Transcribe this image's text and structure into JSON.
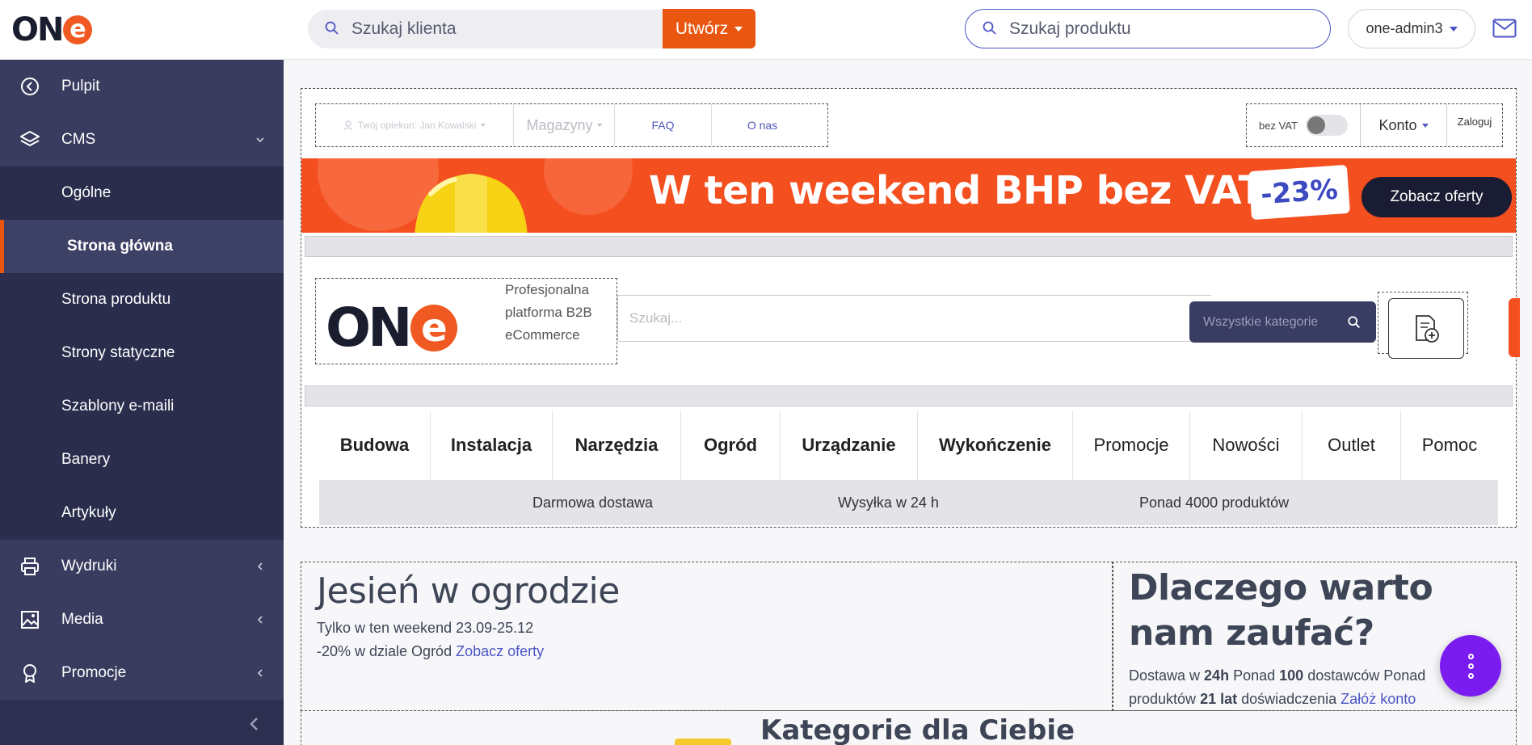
{
  "topbar": {
    "client_search_placeholder": "Szukaj klienta",
    "create_label": "Utwórz",
    "product_search_placeholder": "Szukaj produktu",
    "admin_label": "one-admin3"
  },
  "sidebar": {
    "items": [
      {
        "label": "Pulpit",
        "icon": "dashboard-icon"
      },
      {
        "label": "CMS",
        "icon": "layers-icon"
      },
      {
        "label": "Ogólne"
      },
      {
        "label": "Strona główna",
        "active": true
      },
      {
        "label": "Strona produktu"
      },
      {
        "label": "Strony statyczne"
      },
      {
        "label": "Szablony e-maili"
      },
      {
        "label": "Banery"
      },
      {
        "label": "Artykuły"
      },
      {
        "label": "Wydruki",
        "icon": "printer-icon"
      },
      {
        "label": "Media",
        "icon": "image-icon"
      },
      {
        "label": "Promocje",
        "icon": "award-icon"
      }
    ]
  },
  "preview": {
    "util": {
      "opiekun": "Twój opiekun: Jan Kowalski",
      "magazyny": "Magazyny",
      "faq": "FAQ",
      "onas": "O nas",
      "vat": "bez VAT",
      "konto": "Konto",
      "zaloguj": "Zaloguj"
    },
    "banner": {
      "title": "W ten weekend BHP bez VAT!",
      "discount": "-23%",
      "cta": "Zobacz oferty"
    },
    "header": {
      "tagline": "Profesjonalna platforma B2B eCommerce",
      "search_placeholder": "Szukaj...",
      "category_select": "Wszystkie kategorie"
    },
    "nav": [
      "Budowa",
      "Instalacja",
      "Narzędzia",
      "Ogród",
      "Urządzanie",
      "Wykończenie",
      "Promocje",
      "Nowości",
      "Outlet",
      "Pomoc"
    ],
    "info": [
      "Darmowa dostawa",
      "Wysyłka w 24 h",
      "Ponad 4000 produktów"
    ],
    "promo": {
      "title": "Jesień w ogrodzie",
      "line1": "Tylko w ten weekend 23.09-25.12",
      "line2": "-20% w dziale Ogród",
      "link": "Zobacz oferty"
    },
    "trust": {
      "title": "Dlaczego warto nam zaufać?",
      "t1": "Dostawa w ",
      "b1": "24h",
      "t2": " Ponad ",
      "b2": "100",
      "t3": " dostawców Ponad",
      "t4": "produktów ",
      "b3": "21 lat",
      "t5": " doświadczenia ",
      "link": "Załóż konto"
    },
    "categories_title": "Kategorie dla Ciebie"
  },
  "colors": {
    "accent_orange": "#e8560f",
    "sidebar_bg": "#2d3050",
    "fab_purple": "#7a1cf0",
    "link_blue": "#4b55c4"
  }
}
